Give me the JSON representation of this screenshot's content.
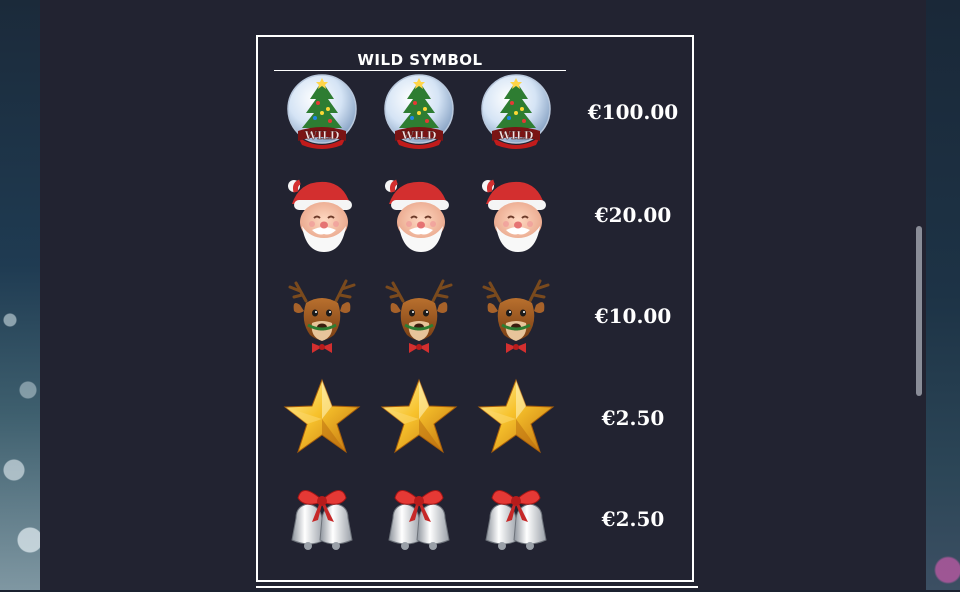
{
  "paytable": {
    "header": "WILD SYMBOL",
    "rows": [
      {
        "symbol": "snow-globe-wild-icon",
        "payout": "€100.00",
        "wild_text": "WILD"
      },
      {
        "symbol": "santa-icon",
        "payout": "€20.00"
      },
      {
        "symbol": "reindeer-icon",
        "payout": "€10.00"
      },
      {
        "symbol": "gold-star-icon",
        "payout": "€2.50"
      },
      {
        "symbol": "silver-bells-icon",
        "payout": "€2.50"
      }
    ]
  },
  "colors": {
    "panel_bg": "#222331",
    "border": "#ffffff",
    "text": "#ffffff"
  }
}
